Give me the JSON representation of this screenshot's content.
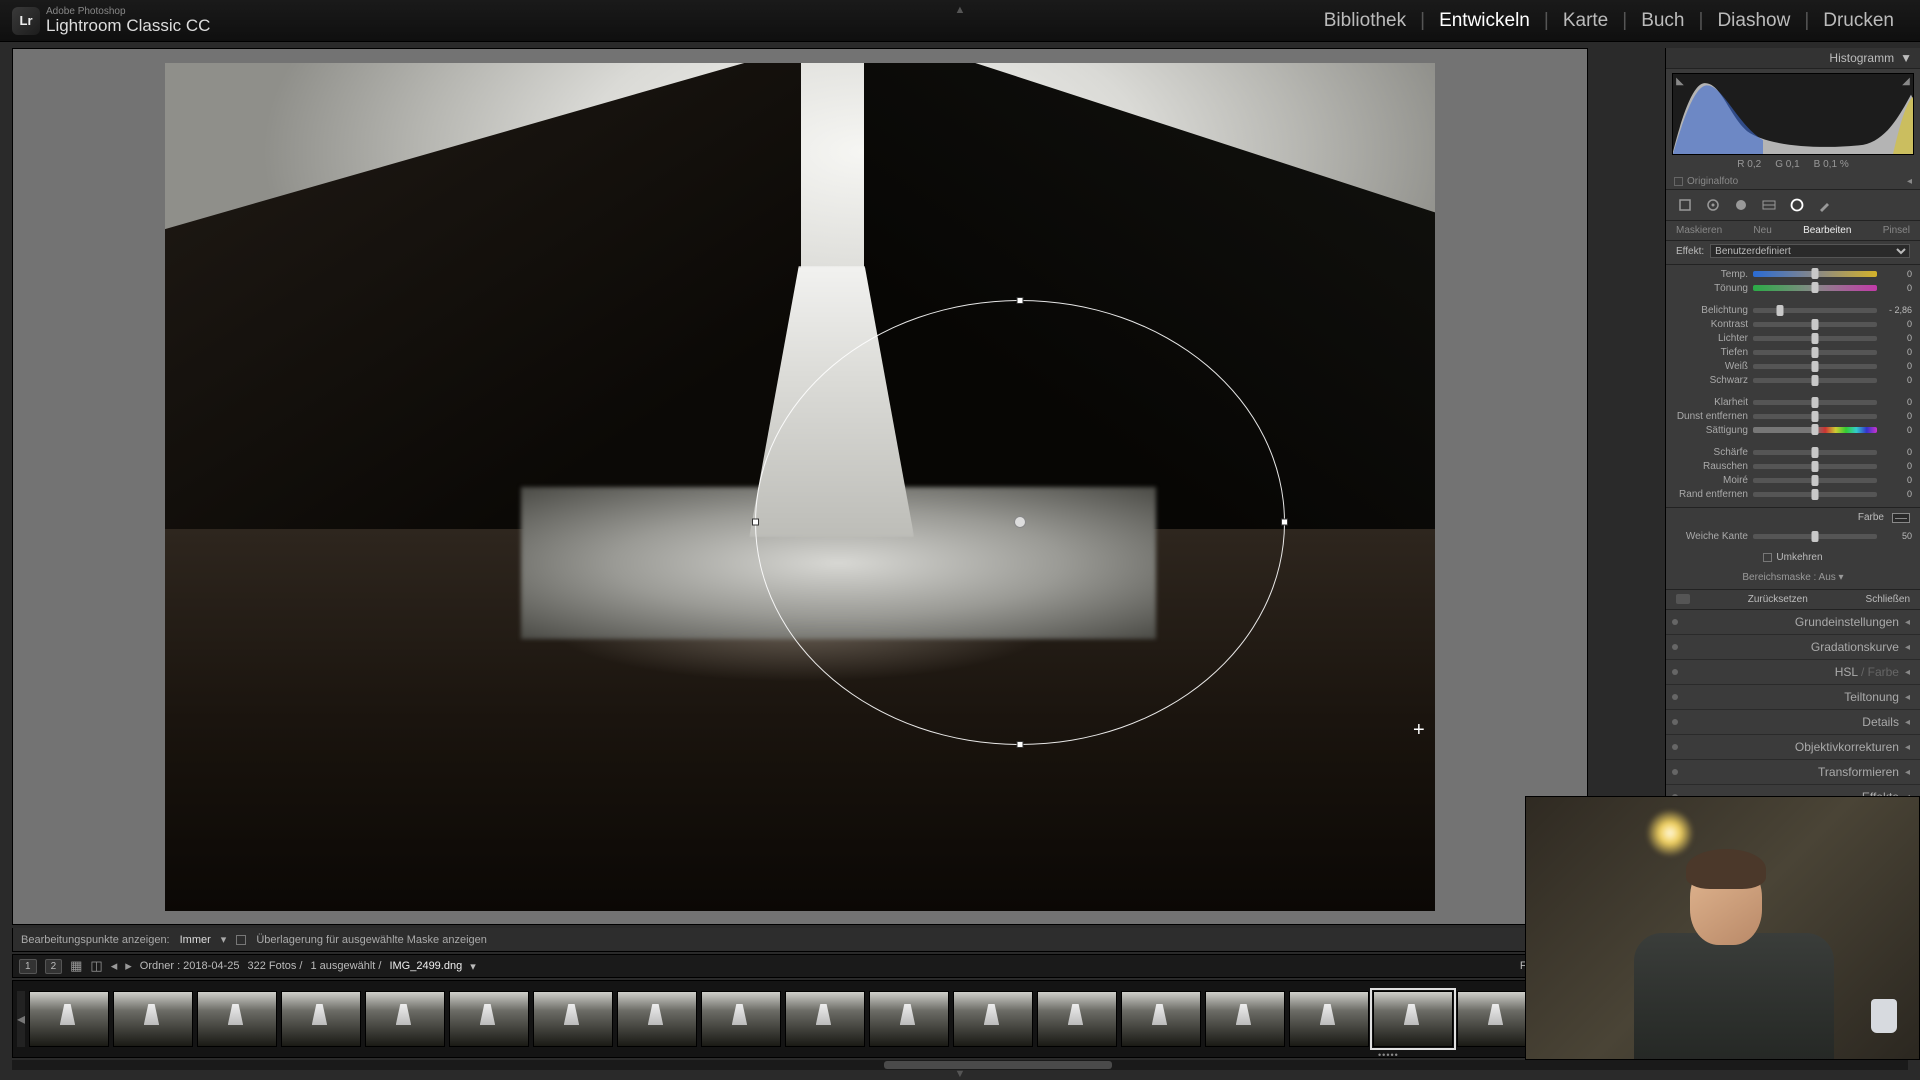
{
  "app": {
    "vendor": "Adobe Photoshop",
    "name": "Lightroom Classic CC",
    "logo_text": "Lr"
  },
  "modules": {
    "library": "Bibliothek",
    "develop": "Entwickeln",
    "map": "Karte",
    "book": "Buch",
    "slideshow": "Diashow",
    "print": "Drucken",
    "active": "develop"
  },
  "histogram": {
    "title": "Histogramm",
    "rgb": {
      "r_label": "R",
      "r": "0,2",
      "g_label": "G",
      "g": "0,1",
      "b_label": "B",
      "b": "0,1",
      "pct": "%"
    },
    "original_label": "Originalfoto"
  },
  "toolstrip": {
    "active": "radial"
  },
  "mask_tabs": {
    "mask": "Maskieren",
    "new": "Neu",
    "edit": "Bearbeiten",
    "brush": "Pinsel",
    "active": "edit"
  },
  "effect": {
    "label": "Effekt:",
    "value": "Benutzerdefiniert"
  },
  "sliders": {
    "temp": {
      "label": "Temp.",
      "value": "0",
      "pos": 50
    },
    "tint": {
      "label": "Tönung",
      "value": "0",
      "pos": 50
    },
    "exposure": {
      "label": "Belichtung",
      "value": "- 2,86",
      "pos": 22
    },
    "contrast": {
      "label": "Kontrast",
      "value": "0",
      "pos": 50
    },
    "highlights": {
      "label": "Lichter",
      "value": "0",
      "pos": 50
    },
    "shadows": {
      "label": "Tiefen",
      "value": "0",
      "pos": 50
    },
    "whites": {
      "label": "Weiß",
      "value": "0",
      "pos": 50
    },
    "blacks": {
      "label": "Schwarz",
      "value": "0",
      "pos": 50
    },
    "clarity": {
      "label": "Klarheit",
      "value": "0",
      "pos": 50
    },
    "dehaze": {
      "label": "Dunst entfernen",
      "value": "0",
      "pos": 50
    },
    "saturation": {
      "label": "Sättigung",
      "value": "0",
      "pos": 50
    },
    "sharpness": {
      "label": "Schärfe",
      "value": "0",
      "pos": 50
    },
    "noise": {
      "label": "Rauschen",
      "value": "0",
      "pos": 50
    },
    "moire": {
      "label": "Moiré",
      "value": "0",
      "pos": 50
    },
    "defringe": {
      "label": "Rand entfernen",
      "value": "0",
      "pos": 50
    },
    "feather": {
      "label": "Weiche Kante",
      "value": "50",
      "pos": 50
    }
  },
  "color": {
    "label": "Farbe"
  },
  "invert": {
    "label": "Umkehren"
  },
  "range_mask": {
    "label": "Bereichsmaske :",
    "value": "Aus"
  },
  "reset": {
    "reset": "Zurücksetzen",
    "close": "Schließen"
  },
  "panels": {
    "basic": "Grundeinstellungen",
    "tone": "Gradationskurve",
    "hsl_a": "HSL",
    "hsl_b": " / Farbe",
    "split": "Teiltonung",
    "detail": "Details",
    "lens": "Objektivkorrekturen",
    "transform": "Transformieren",
    "effects": "Effekte"
  },
  "underbar": {
    "label": "Bearbeitungspunkte anzeigen:",
    "mode": "Immer",
    "overlay": "Überlagerung für ausgewählte Maske anzeigen"
  },
  "secbar": {
    "xy": "1",
    "yx": "2",
    "folder": "Ordner : 2018-04-25",
    "count": "322 Fotos /",
    "sel": "1 ausgewählt /",
    "file": "IMG_2499.dng",
    "filter": "Filter:"
  }
}
